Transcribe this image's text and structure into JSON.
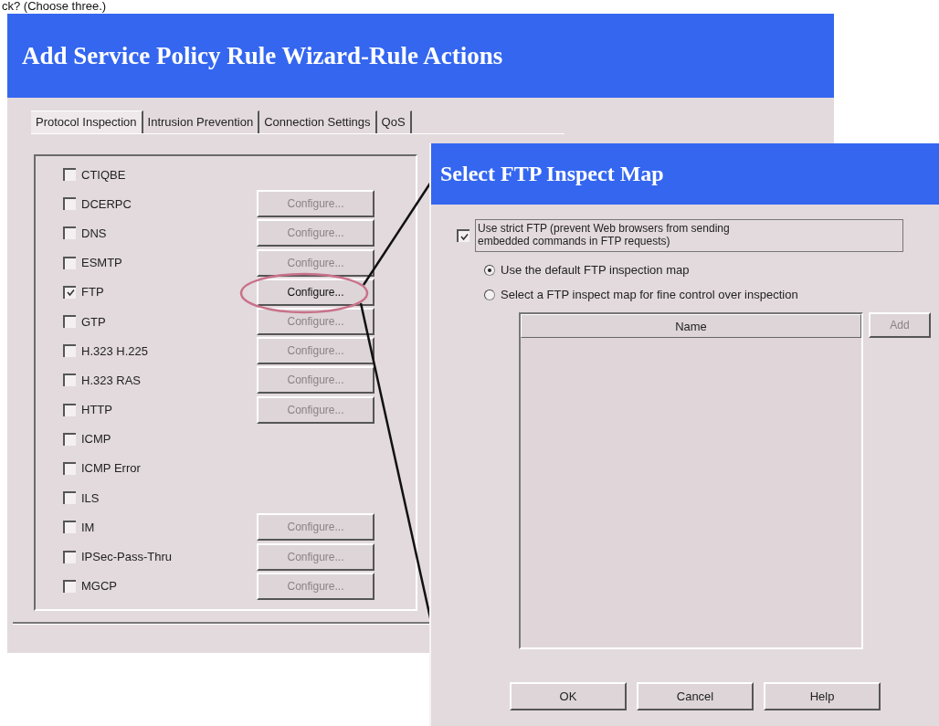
{
  "caption": "ck? (Choose three.)",
  "main_dialog": {
    "title": "Add Service Policy Rule Wizard-Rule Actions",
    "tabs": [
      {
        "label": "Protocol Inspection",
        "selected": true
      },
      {
        "label": "Intrusion Prevention",
        "selected": false
      },
      {
        "label": "Connection Settings",
        "selected": false
      },
      {
        "label": "QoS",
        "selected": false
      }
    ],
    "protocols": [
      {
        "name": "CTIQBE",
        "checked": false
      },
      {
        "name": "DCERPC",
        "checked": false,
        "configure": {
          "label": "Configure...",
          "disabled": true
        }
      },
      {
        "name": "DNS",
        "checked": false,
        "configure": {
          "label": "Configure...",
          "disabled": true
        }
      },
      {
        "name": "ESMTP",
        "checked": false,
        "configure": {
          "label": "Configure...",
          "disabled": true
        }
      },
      {
        "name": "FTP",
        "checked": true,
        "configure": {
          "label": "Configure...",
          "disabled": false
        }
      },
      {
        "name": "GTP",
        "checked": false,
        "configure": {
          "label": "Configure...",
          "disabled": true
        }
      },
      {
        "name": "H.323 H.225",
        "checked": false,
        "configure": {
          "label": "Configure...",
          "disabled": true
        }
      },
      {
        "name": "H.323 RAS",
        "checked": false,
        "configure": {
          "label": "Configure...",
          "disabled": true
        }
      },
      {
        "name": "HTTP",
        "checked": false,
        "configure": {
          "label": "Configure...",
          "disabled": true
        }
      },
      {
        "name": "ICMP",
        "checked": false
      },
      {
        "name": "ICMP Error",
        "checked": false
      },
      {
        "name": "ILS",
        "checked": false
      },
      {
        "name": "IM",
        "checked": false,
        "configure": {
          "label": "Configure...",
          "disabled": true
        }
      },
      {
        "name": "IPSec-Pass-Thru",
        "checked": false,
        "configure": {
          "label": "Configure...",
          "disabled": true
        }
      },
      {
        "name": "MGCP",
        "checked": false,
        "configure": {
          "label": "Configure...",
          "disabled": true
        }
      }
    ]
  },
  "ftp_dialog": {
    "title": "Select FTP Inspect Map",
    "strict_ftp": {
      "label": "Use strict FTP (prevent Web browsers from sending embedded commands in FTP requests)",
      "checked": true
    },
    "options": [
      {
        "label": "Use the default FTP inspection map",
        "selected": true
      },
      {
        "label": "Select a FTP inspect map for fine control over inspection",
        "selected": false
      }
    ],
    "table": {
      "columns": [
        "Name"
      ]
    },
    "add_button": {
      "label": "Add",
      "disabled": true
    },
    "buttons": [
      "OK",
      "Cancel",
      "Help"
    ]
  }
}
